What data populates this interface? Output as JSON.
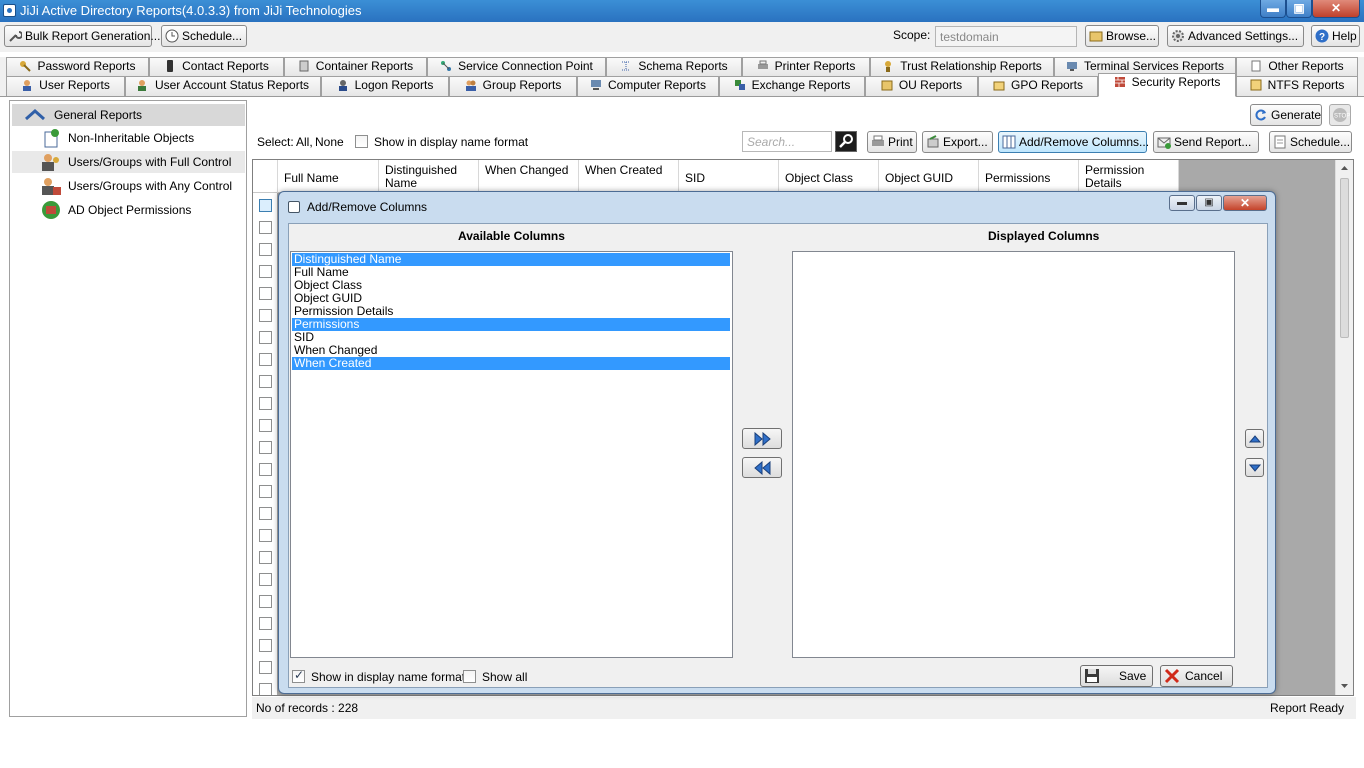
{
  "window": {
    "title": "JiJi Active Directory Reports(4.0.3.3) from JiJi Technologies",
    "min_label": "▬",
    "max_label": "▣",
    "close_label": "✕"
  },
  "toolbar": {
    "bulk_label": "Bulk Report Generation...",
    "schedule_label": "Schedule...",
    "scope_label": "Scope:",
    "scope_value": "testdomain",
    "browse_label": "Browse...",
    "advanced_label": "Advanced Settings...",
    "help_label": "Help"
  },
  "tabs_row1": [
    {
      "label": "Password Reports",
      "icon": "key-icon"
    },
    {
      "label": "Contact Reports",
      "icon": "phone-icon"
    },
    {
      "label": "Container Reports",
      "icon": "container-icon"
    },
    {
      "label": "Service Connection Point",
      "icon": "connection-icon"
    },
    {
      "label": "Schema Reports",
      "icon": "schema-icon"
    },
    {
      "label": "Printer Reports",
      "icon": "printer-icon"
    },
    {
      "label": "Trust Relationship Reports",
      "icon": "trust-icon"
    },
    {
      "label": "Terminal Services Reports",
      "icon": "terminal-icon"
    },
    {
      "label": "Other Reports",
      "icon": "document-icon"
    }
  ],
  "tabs_row2": [
    {
      "label": "User Reports",
      "icon": "user-icon"
    },
    {
      "label": "User Account Status Reports",
      "icon": "user-status-icon"
    },
    {
      "label": "Logon Reports",
      "icon": "logon-icon"
    },
    {
      "label": "Group Reports",
      "icon": "group-icon"
    },
    {
      "label": "Computer Reports",
      "icon": "computer-icon"
    },
    {
      "label": "Exchange Reports",
      "icon": "exchange-icon"
    },
    {
      "label": "OU Reports",
      "icon": "ou-icon"
    },
    {
      "label": "GPO Reports",
      "icon": "gpo-icon"
    },
    {
      "label": "Security Reports",
      "icon": "security-icon"
    },
    {
      "label": "NTFS Reports",
      "icon": "ntfs-icon"
    }
  ],
  "tree": {
    "header": "General Reports",
    "items": [
      {
        "label": "Non-Inheritable Objects"
      },
      {
        "label": "Users/Groups with Full Control"
      },
      {
        "label": "Users/Groups with Any Control"
      },
      {
        "label": "AD Object Permissions"
      }
    ]
  },
  "report": {
    "select_label": "Select:",
    "select_all": "All,",
    "select_none": "None",
    "display_name_label": "Show in display name format",
    "search_placeholder": "Search...",
    "generate_label": "Generate",
    "print_label": "Print",
    "export_label": "Export...",
    "add_remove_label": "Add/Remove Columns...",
    "send_label": "Send Report...",
    "schedule_label": "Schedule...",
    "columns": [
      "Full Name",
      "Distinguished Name",
      "When Changed",
      "When Created",
      "SID",
      "Object Class",
      "Object GUID",
      "Permissions",
      "Permission Details"
    ]
  },
  "status": {
    "records": "No of records : 228",
    "state": "Report Ready"
  },
  "dialog": {
    "title": "Add/Remove Columns",
    "available_title": "Available Columns",
    "displayed_title": "Displayed Columns",
    "available": [
      {
        "label": "Distinguished Name",
        "selected": true
      },
      {
        "label": "Full Name",
        "selected": false
      },
      {
        "label": "Object Class",
        "selected": false
      },
      {
        "label": "Object GUID",
        "selected": false
      },
      {
        "label": "Permission Details",
        "selected": false
      },
      {
        "label": "Permissions",
        "selected": true
      },
      {
        "label": "SID",
        "selected": false
      },
      {
        "label": "When Changed",
        "selected": false
      },
      {
        "label": "When Created",
        "selected": true
      }
    ],
    "displayed": [],
    "show_display_name_label": "Show in display name format",
    "show_display_name_checked": true,
    "show_all_label": "Show all",
    "show_all_checked": false,
    "save_label": "Save",
    "cancel_label": "Cancel"
  }
}
